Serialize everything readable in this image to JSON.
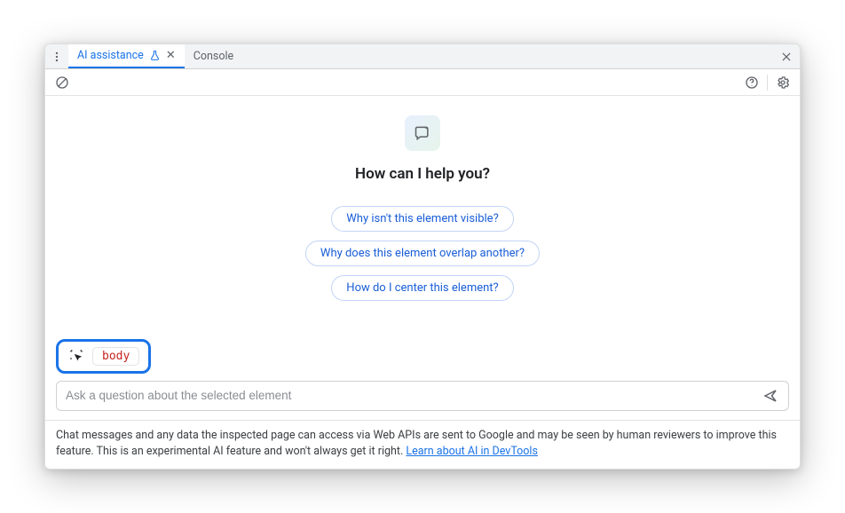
{
  "tabs": {
    "active_label": "AI assistance",
    "inactive_label": "Console"
  },
  "heading": "How can I help you?",
  "suggestions": [
    "Why isn't this element visible?",
    "Why does this element overlap another?",
    "How do I center this element?"
  ],
  "selected_element": "body",
  "input": {
    "placeholder": "Ask a question about the selected element"
  },
  "footer": {
    "text": "Chat messages and any data the inspected page can access via Web APIs are sent to Google and may be seen by human reviewers to improve this feature. This is an experimental AI feature and won't always get it right. ",
    "link_text": "Learn about AI in DevTools"
  }
}
